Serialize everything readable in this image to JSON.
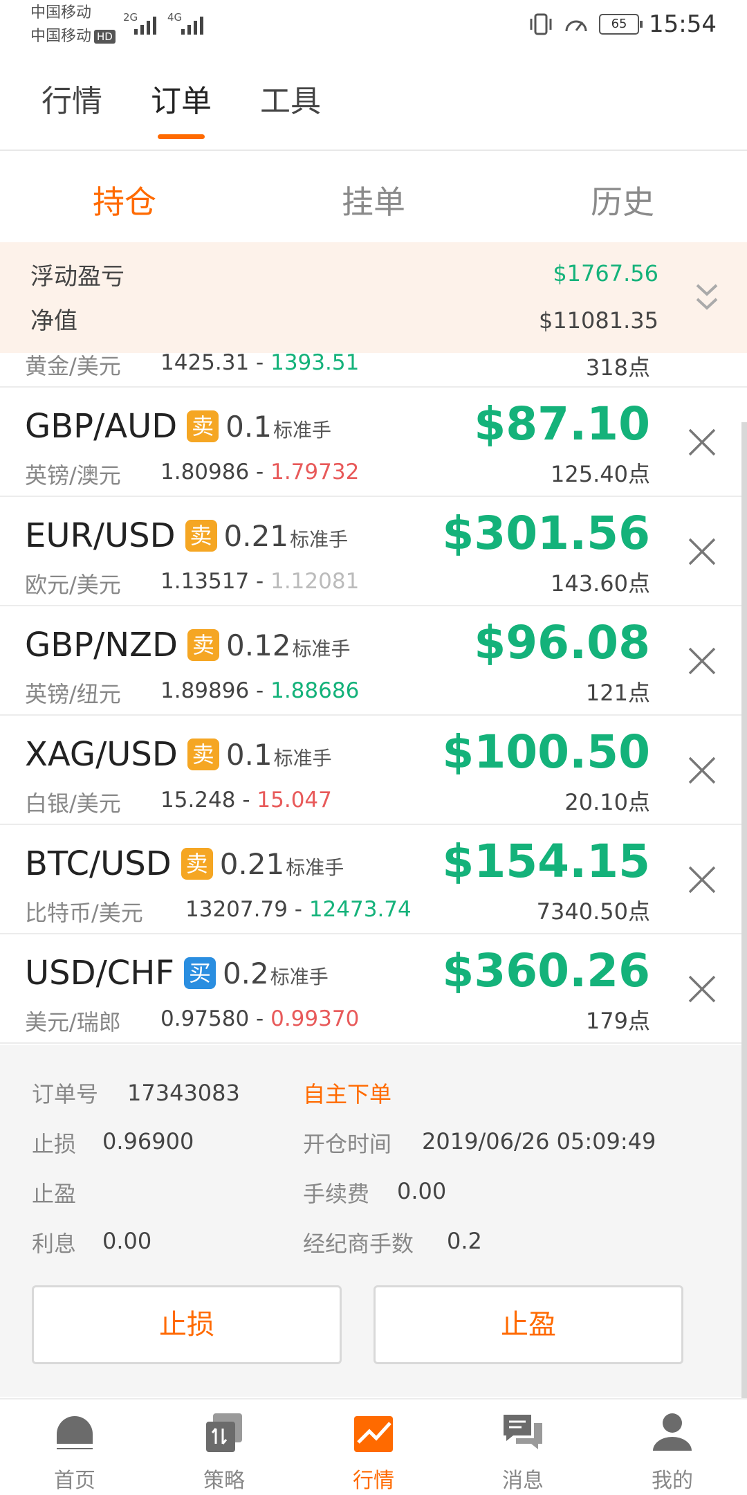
{
  "status_bar": {
    "carrier1": "中国移动",
    "carrier2": "中国移动",
    "hd": "HD",
    "net1": "2G",
    "net2": "4G",
    "battery": "65",
    "time": "15:54"
  },
  "top_tabs": [
    "行情",
    "订单",
    "工具"
  ],
  "sub_tabs": [
    "持仓",
    "挂单",
    "历史"
  ],
  "summary": {
    "float_label": "浮动盈亏",
    "float_value": "$1767.56",
    "equity_label": "净值",
    "equity_value": "$11081.35"
  },
  "partial_row": {
    "name": "黄金/美元",
    "open": "1425.31",
    "sep": " - ",
    "current": "1393.51",
    "points": "318点"
  },
  "positions": [
    {
      "symbol": "GBP/AUD",
      "side": "卖",
      "lots": "0.1",
      "unit": "标准手",
      "name": "英镑/澳元",
      "open": "1.80986",
      "sep": " - ",
      "current": "1.79732",
      "pl": "$87.10",
      "points": "125.40点"
    },
    {
      "symbol": "EUR/USD",
      "side": "卖",
      "lots": "0.21",
      "unit": "标准手",
      "name": "欧元/美元",
      "open": "1.13517",
      "sep": " - ",
      "current": "1.12081",
      "pl": "$301.56",
      "points": "143.60点"
    },
    {
      "symbol": "GBP/NZD",
      "side": "卖",
      "lots": "0.12",
      "unit": "标准手",
      "name": "英镑/纽元",
      "open": "1.89896",
      "sep": " - ",
      "current": "1.88686",
      "pl": "$96.08",
      "points": "121点"
    },
    {
      "symbol": "XAG/USD",
      "side": "卖",
      "lots": "0.1",
      "unit": "标准手",
      "name": "白银/美元",
      "open": "15.248",
      "sep": " - ",
      "current": "15.047",
      "pl": "$100.50",
      "points": "20.10点"
    },
    {
      "symbol": "BTC/USD",
      "side": "卖",
      "lots": "0.21",
      "unit": "标准手",
      "name": "比特币/美元",
      "open": "13207.79",
      "sep": " - ",
      "current": "12473.74",
      "pl": "$154.15",
      "points": "7340.50点"
    },
    {
      "symbol": "USD/CHF",
      "side": "买",
      "lots": "0.2",
      "unit": "标准手",
      "name": "美元/瑞郎",
      "open": "0.97580",
      "sep": " - ",
      "current": "0.99370",
      "pl": "$360.26",
      "points": "179点"
    }
  ],
  "details": {
    "order_no_label": "订单号",
    "order_no": "17343083",
    "source": "自主下单",
    "stop_loss_label": "止损",
    "stop_loss": "0.96900",
    "open_time_label": "开仓时间",
    "open_time": "2019/06/26 05:09:49",
    "take_profit_label": "止盈",
    "fee_label": "手续费",
    "fee": "0.00",
    "interest_label": "利息",
    "interest": "0.00",
    "broker_lots_label": "经纪商手数",
    "broker_lots": "0.2",
    "btn_stop_loss": "止损",
    "btn_take_profit": "止盈"
  },
  "nav": [
    {
      "label": "首页",
      "icon": "home-icon"
    },
    {
      "label": "策略",
      "icon": "strategy-icon"
    },
    {
      "label": "行情",
      "icon": "market-icon"
    },
    {
      "label": "消息",
      "icon": "message-icon"
    },
    {
      "label": "我的",
      "icon": "profile-icon"
    }
  ],
  "colors": {
    "accent": "#ff6a00",
    "profit_green": "#14b27a",
    "loss_red": "#e85a5a",
    "sell_badge": "#f5a623",
    "buy_badge": "#2a8ee0",
    "summary_bg": "#fdf2ea"
  }
}
